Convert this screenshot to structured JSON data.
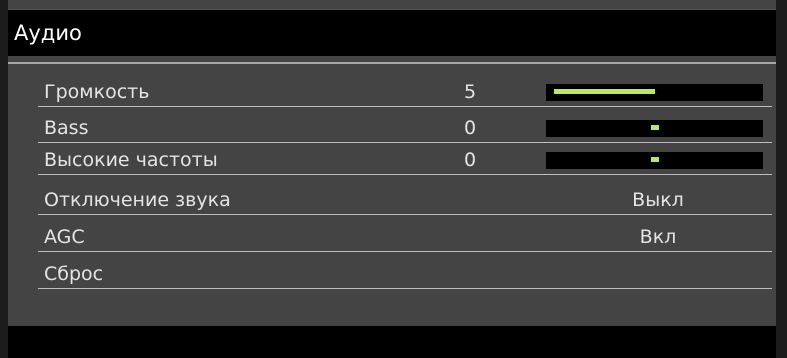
{
  "title": "Аудио",
  "accent_color": "#b6ec5c",
  "rows": [
    {
      "label": "Громкость",
      "number": "5",
      "slider_level": 0.5
    },
    {
      "label": "Bass",
      "number": "0",
      "slider_level": 0.0
    },
    {
      "label": "Высокие частоты",
      "number": "0",
      "slider_level": 0.0
    },
    {
      "label": "Отключение звука",
      "value": "Выкл"
    },
    {
      "label": "AGC",
      "value": "Вкл"
    },
    {
      "label": "Сброс"
    }
  ]
}
